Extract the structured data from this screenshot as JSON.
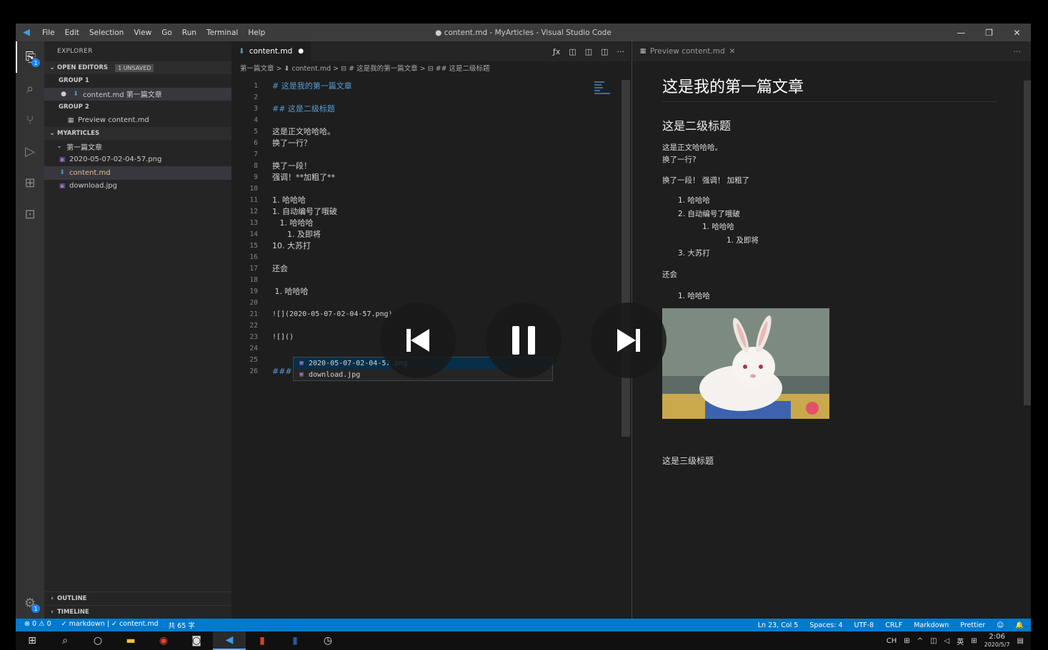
{
  "window": {
    "title": "● content.md - MyArticles - Visual Studio Code",
    "menu": [
      "File",
      "Edit",
      "Selection",
      "View",
      "Go",
      "Run",
      "Terminal",
      "Help"
    ]
  },
  "activity_bar": {
    "explorer_badge": "1",
    "settings_badge": "1"
  },
  "sidebar": {
    "title": "EXPLORER",
    "open_editors": {
      "label": "OPEN EDITORS",
      "badge": "1 UNSAVED"
    },
    "group1": "GROUP 1",
    "group1_item": "content.md 第一篇文章",
    "group2": "GROUP 2",
    "group2_item": "Preview content.md",
    "workspace": "MYARTICLES",
    "folder": "第一篇文章",
    "files": [
      "2020-05-07-02-04-57.png",
      "content.md",
      "download.jpg"
    ],
    "outline": "OUTLINE",
    "timeline": "TIMELINE"
  },
  "editor": {
    "tab": "content.md",
    "breadcrumb": "第一篇文章 > ⬇ content.md > ⊟ # 这是我的第一篇文章 > ⊟ ## 这是二级标题",
    "lines": [
      {
        "n": "1",
        "t": "# 这是我的第一篇文章"
      },
      {
        "n": "2",
        "t": ""
      },
      {
        "n": "3",
        "t": "## 这是二级标题"
      },
      {
        "n": "4",
        "t": ""
      },
      {
        "n": "5",
        "t": "这是正文哈哈哈。"
      },
      {
        "n": "6",
        "t": "换了一行？"
      },
      {
        "n": "7",
        "t": ""
      },
      {
        "n": "8",
        "t": "换了一段！"
      },
      {
        "n": "9",
        "t": "强调！**加粗了**"
      },
      {
        "n": "10",
        "t": ""
      },
      {
        "n": "11",
        "t": "1. 哈哈哈"
      },
      {
        "n": "12",
        "t": "1. 自动编号了哦破"
      },
      {
        "n": "13",
        "t": "   1. 哈哈哈"
      },
      {
        "n": "14",
        "t": "      1. 及即将"
      },
      {
        "n": "15",
        "t": "10. 大苏打"
      },
      {
        "n": "16",
        "t": ""
      },
      {
        "n": "17",
        "t": "还会"
      },
      {
        "n": "18",
        "t": ""
      },
      {
        "n": "19",
        "t": " 1. 哈哈哈"
      },
      {
        "n": "20",
        "t": ""
      },
      {
        "n": "21",
        "t": "![](2020-05-07-02-04-57.png)"
      },
      {
        "n": "22",
        "t": ""
      },
      {
        "n": "23",
        "t": "![]()"
      },
      {
        "n": "24",
        "t": ""
      },
      {
        "n": "25",
        "t": ""
      },
      {
        "n": "26",
        "t": "### 这是三级标题"
      }
    ],
    "suggestions": [
      "2020-05-07-02-04-57.png",
      "download.jpg"
    ]
  },
  "preview": {
    "tab": "Preview content.md",
    "h1": "这是我的第一篇文章",
    "h2": "这是二级标题",
    "p1a": "这是正文哈哈哈。",
    "p1b": "换了一行?",
    "p2": "换了一段！ 强调！ 加粗了",
    "list": [
      "1. 哈哈哈",
      "2. 自动编号了哦破",
      "1. 哈哈哈",
      "1. 及即将",
      "3. 大苏打"
    ],
    "p3": "还会",
    "list2": "1. 哈哈哈",
    "h3": "这是三级标题"
  },
  "statusbar": {
    "problems": "⊗ 0 ⚠ 0",
    "left2": "✓ markdown | ✓ content.md",
    "words": "共 65 字",
    "position": "Ln 23, Col 5",
    "spaces": "Spaces: 4",
    "encoding": "UTF-8",
    "eol": "CRLF",
    "language": "Markdown",
    "formatter": "Prettier"
  },
  "taskbar": {
    "ime": "CH",
    "lang": "英",
    "time": "2:06",
    "date": "2020/5/7"
  }
}
